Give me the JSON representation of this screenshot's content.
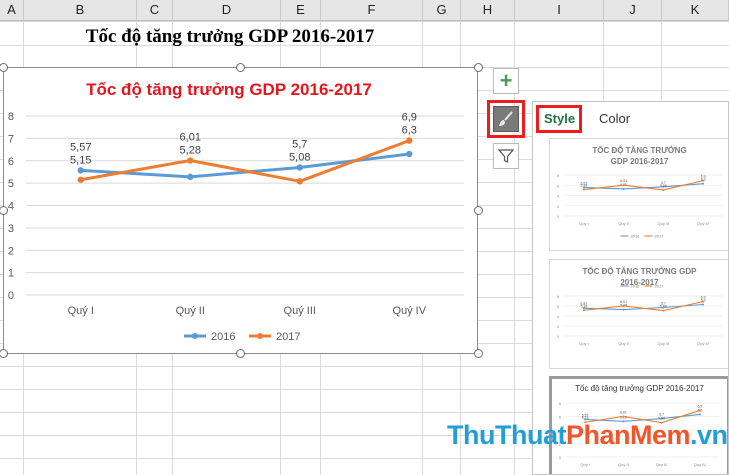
{
  "columns": [
    "A",
    "B",
    "C",
    "D",
    "E",
    "F",
    "G",
    "H",
    "I",
    "J",
    "K"
  ],
  "sheet_title": "Tốc độ tăng trưởng GDP 2016-2017",
  "chart_data": {
    "type": "line",
    "title": "Tốc độ tăng trưởng GDP 2016-2017",
    "categories": [
      "Quý I",
      "Quý II",
      "Quý III",
      "Quý IV"
    ],
    "series": [
      {
        "name": "2016",
        "values": [
          5.57,
          5.28,
          5.7,
          6.3
        ],
        "labels": [
          "5,57",
          "5,28",
          "5,7",
          "6,3"
        ],
        "color": "#5b9bd5"
      },
      {
        "name": "2017",
        "values": [
          5.15,
          6.01,
          5.08,
          6.9
        ],
        "labels": [
          "5,15",
          "6,01",
          "5,08",
          "6,9"
        ],
        "color": "#ed7d31"
      }
    ],
    "yticks": [
      "0",
      "1",
      "2",
      "3",
      "4",
      "5",
      "6",
      "7",
      "8"
    ],
    "ylim": [
      0,
      8
    ],
    "grid": true,
    "legend": "bottom"
  },
  "side_buttons": {
    "elements": "+",
    "styles": "brush",
    "filters": "funnel"
  },
  "pane": {
    "tab_style": "Style",
    "tab_color": "Color",
    "thumbs": [
      {
        "title_line1": "TỐC ĐỘ TĂNG TRƯỞNG",
        "title_line2": "GDP 2016-2017"
      },
      {
        "title_line1": "TỐC ĐỘ TĂNG TRƯỞNG GDP",
        "title_line2": "2016-2017"
      },
      {
        "title_line1": "Tốc độ tăng trưởng GDP 2016-2017",
        "title_line2": ""
      }
    ]
  },
  "watermark": {
    "part1": "ThuThuat",
    "part2": "PhanMem",
    "part3": ".vn"
  },
  "colors": {
    "accent_red": "#ee1c1c",
    "title_red": "#e3161d",
    "style_green": "#217346"
  }
}
